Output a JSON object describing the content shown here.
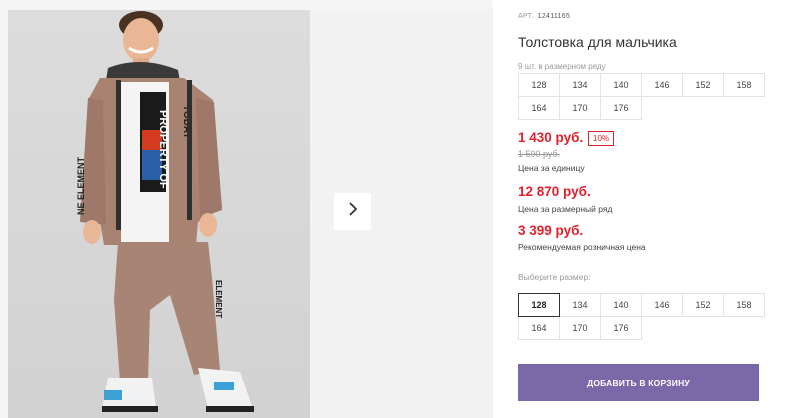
{
  "product": {
    "sku_label": "АРТ.",
    "sku": "12411165",
    "title": "Толстовка для мальчика",
    "pack_note": "9 шт. в размерном ряду",
    "pack_sizes": [
      "128",
      "134",
      "140",
      "146",
      "152",
      "158",
      "164",
      "170",
      "176"
    ],
    "price": "1 430 руб.",
    "discount": "10%",
    "old_price": "1 590 руб.",
    "unit_caption": "Цена за единицу",
    "pack_price": "12 870 руб.",
    "pack_caption": "Цена за размерный ряд",
    "rrp_price": "3 399 руб.",
    "rrp_caption": "Рекомендуемая розничная цена",
    "select_label": "Выберите размер:",
    "sizes": [
      "128",
      "134",
      "140",
      "146",
      "152",
      "158",
      "164",
      "170",
      "176"
    ],
    "selected_size": "128",
    "cart_button": "ДОБАВИТЬ В КОРЗИНУ"
  },
  "gallery": {
    "next_icon": "chevron-right-icon",
    "shirt_print": "PROPERTY OF",
    "shirt_print_2": "TODAY",
    "sleeve_print": "NE ELEMENT",
    "pants_print": "ELEMENT"
  },
  "colors": {
    "price_red": "#e0212c",
    "button_purple": "#7b68a9"
  }
}
